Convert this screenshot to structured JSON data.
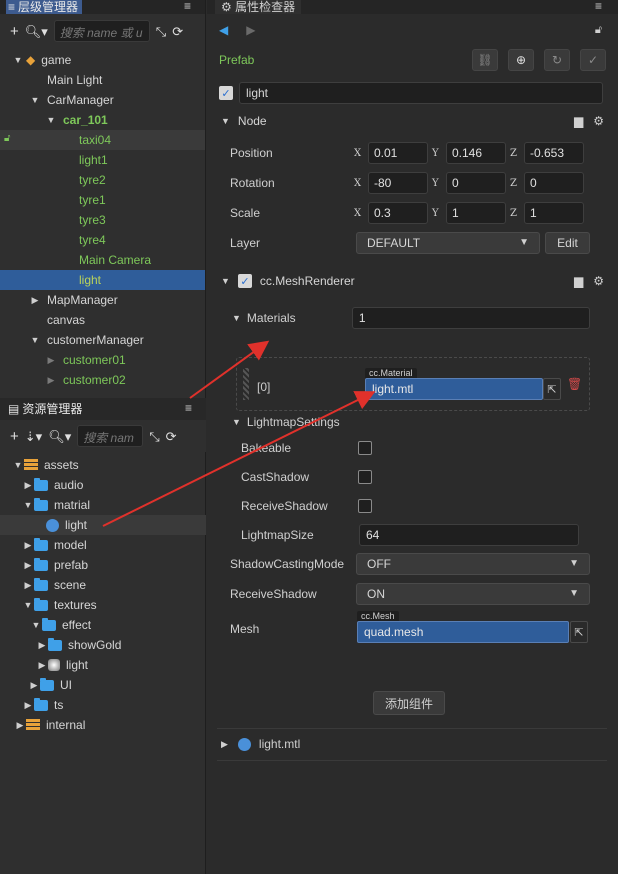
{
  "hierarchy": {
    "title": "层级管理器",
    "search_placeholder": "搜索 name 或 u",
    "nodes": [
      "game",
      "Main Light",
      "CarManager",
      "car_101",
      "taxi04",
      "light1",
      "tyre2",
      "tyre1",
      "tyre3",
      "tyre4",
      "Main Camera",
      "light",
      "MapManager",
      "canvas",
      "customerManager",
      "customer01",
      "customer02"
    ]
  },
  "assets": {
    "title": "资源管理器",
    "search_placeholder": "搜索 nam",
    "nodes": [
      "assets",
      "audio",
      "matrial",
      "light",
      "model",
      "prefab",
      "scene",
      "textures",
      "effect",
      "showGold",
      "light",
      "UI",
      "ts",
      "internal"
    ]
  },
  "inspector": {
    "title": "属性检查器",
    "prefab_label": "Prefab",
    "node_name": "light",
    "node_section": "Node",
    "position": {
      "label": "Position",
      "x": "0.01",
      "y": "0.146",
      "z": "-0.653"
    },
    "rotation": {
      "label": "Rotation",
      "x": "-80",
      "y": "0",
      "z": "0"
    },
    "scale": {
      "label": "Scale",
      "x": "0.3",
      "y": "1",
      "z": "1"
    },
    "axis": {
      "x": "X",
      "y": "Y",
      "z": "Z"
    },
    "layer": {
      "label": "Layer",
      "value": "DEFAULT",
      "edit": "Edit"
    },
    "mesh_renderer": "cc.MeshRenderer",
    "materials": {
      "label": "Materials",
      "count": "1",
      "index": "[0]",
      "type": "cc.Material",
      "value": "light.mtl"
    },
    "lightmap": {
      "label": "LightmapSettings",
      "bakeable": "Bakeable",
      "cast_shadow": "CastShadow",
      "receive_shadow": "ReceiveShadow",
      "lightmap_size_label": "LightmapSize",
      "lightmap_size": "64"
    },
    "shadow_casting": {
      "label": "ShadowCastingMode",
      "value": "OFF"
    },
    "receive_shadow": {
      "label": "ReceiveShadow",
      "value": "ON"
    },
    "mesh": {
      "label": "Mesh",
      "type": "cc.Mesh",
      "value": "quad.mesh"
    },
    "add_component": "添加组件",
    "material_asset": "light.mtl"
  },
  "colors": {
    "selection": "#2f5d9a",
    "accent": "#3fa0e8",
    "prefab": "#7ec85a",
    "annotation": "#e0312b"
  }
}
